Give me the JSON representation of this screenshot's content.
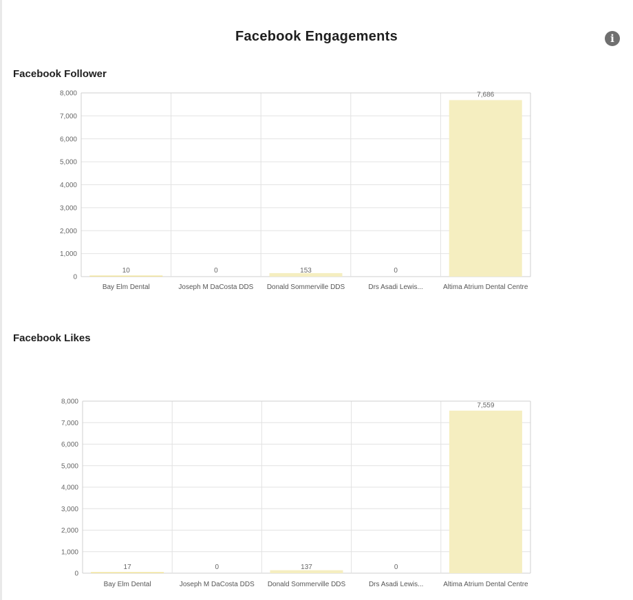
{
  "page": {
    "title": "Facebook Engagements",
    "info_icon": "info-icon"
  },
  "colors": {
    "bar": "#f5eec0",
    "bar_small": "#f2e39a",
    "grid": "#e2e2e2"
  },
  "chart_data": [
    {
      "type": "bar",
      "title": "Facebook Follower",
      "categories": [
        "Bay Elm Dental",
        "Joseph M DaCosta DDS",
        "Donald Sommerville DDS",
        "Drs Asadi Lewis...",
        "Altima Atrium Dental Centre"
      ],
      "values": [
        10,
        0,
        153,
        0,
        7686
      ],
      "value_labels": [
        "10",
        "0",
        "153",
        "0",
        "7,686"
      ],
      "ylim": [
        0,
        8000
      ],
      "yticks": [
        0,
        1000,
        2000,
        3000,
        4000,
        5000,
        6000,
        7000,
        8000
      ],
      "ytick_labels": [
        "0",
        "1,000",
        "2,000",
        "3,000",
        "4,000",
        "5,000",
        "6,000",
        "7,000",
        "8,000"
      ],
      "grid": true,
      "xlabel": "",
      "ylabel": ""
    },
    {
      "type": "bar",
      "title": "Facebook Likes",
      "categories": [
        "Bay Elm Dental",
        "Joseph M DaCosta DDS",
        "Donald Sommerville DDS",
        "Drs Asadi Lewis...",
        "Altima Atrium Dental Centre"
      ],
      "values": [
        17,
        0,
        137,
        0,
        7559
      ],
      "value_labels": [
        "17",
        "0",
        "137",
        "0",
        "7,559"
      ],
      "ylim": [
        0,
        8000
      ],
      "yticks": [
        0,
        1000,
        2000,
        3000,
        4000,
        5000,
        6000,
        7000,
        8000
      ],
      "ytick_labels": [
        "0",
        "1,000",
        "2,000",
        "3,000",
        "4,000",
        "5,000",
        "6,000",
        "7,000",
        "8,000"
      ],
      "grid": true,
      "xlabel": "",
      "ylabel": ""
    }
  ]
}
